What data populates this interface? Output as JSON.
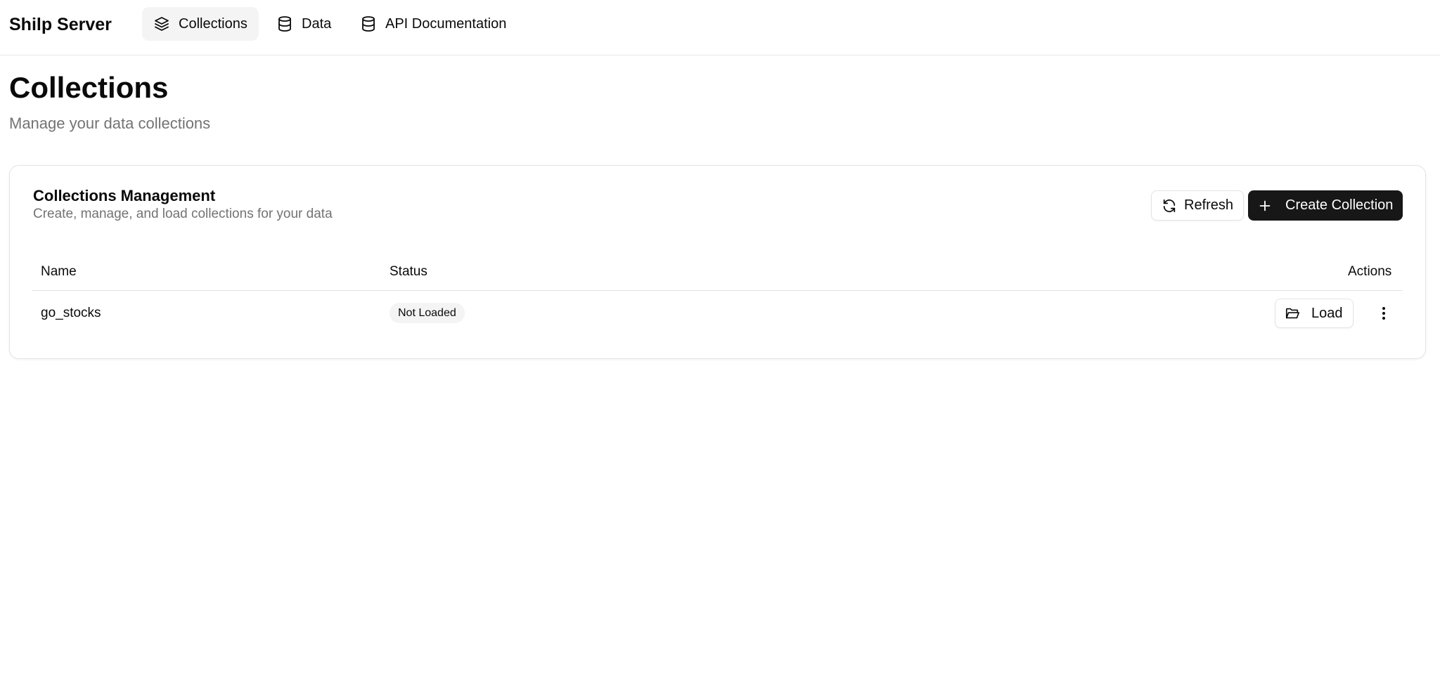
{
  "app": {
    "brand": "Shilp Server"
  },
  "nav": {
    "items": [
      {
        "label": "Collections",
        "icon": "layers-icon",
        "active": true
      },
      {
        "label": "Data",
        "icon": "database-icon",
        "active": false
      },
      {
        "label": "API Documentation",
        "icon": "database-icon",
        "active": false
      }
    ]
  },
  "page": {
    "title": "Collections",
    "subtitle": "Manage your data collections"
  },
  "card": {
    "title": "Collections Management",
    "description": "Create, manage, and load collections for your data",
    "refresh_label": "Refresh",
    "create_label": "Create Collection"
  },
  "table": {
    "columns": [
      "Name",
      "Status",
      "Actions"
    ],
    "rows": [
      {
        "name": "go_stocks",
        "status": "Not Loaded",
        "action_label": "Load"
      }
    ]
  },
  "colors": {
    "primary_button": "#171717",
    "active_nav_bg": "#f4f4f5",
    "muted_text": "#737373",
    "border": "#e4e4e7"
  }
}
